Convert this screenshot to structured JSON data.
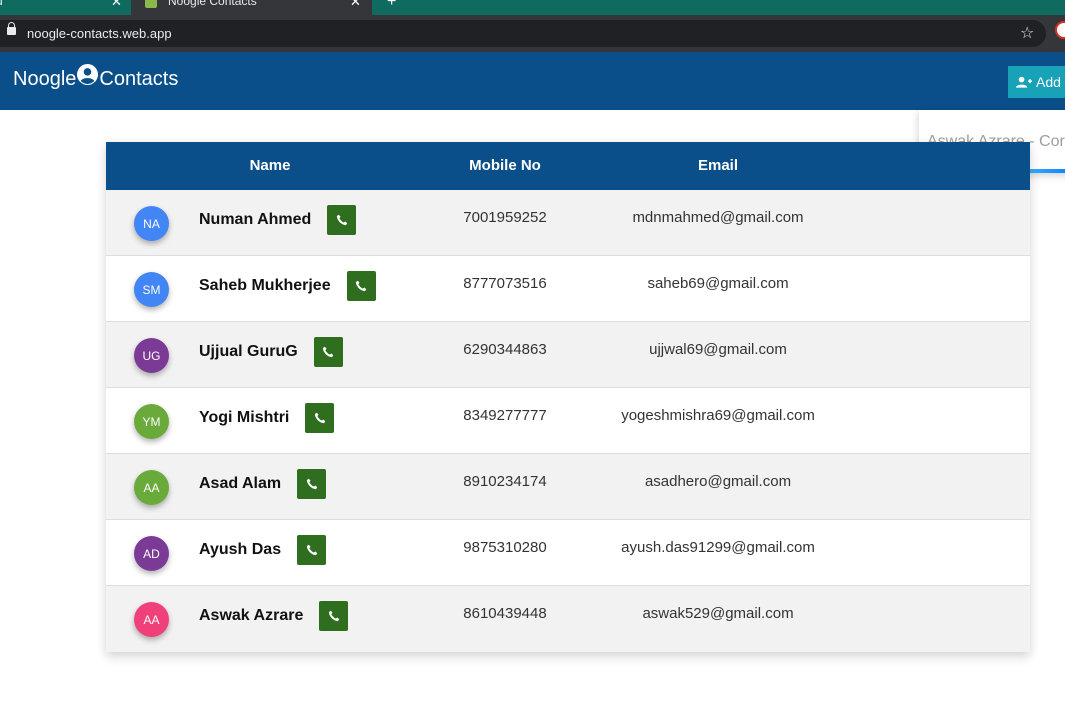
{
  "browser": {
    "tabs": [
      {
        "title": "d"
      },
      {
        "title": "Noogle Contacts"
      }
    ],
    "url": "noogle-contacts.web.app"
  },
  "navbar": {
    "brand_left": "Noogle",
    "brand_right": "Contacts",
    "add_label": "Add"
  },
  "toast": {
    "text": "Aswak Azrare - Cor"
  },
  "table": {
    "headers": [
      "Name",
      "Mobile No",
      "Email"
    ],
    "rows": [
      {
        "initials": "NA",
        "avatar_color": "#4285f4",
        "name": "Numan Ahmed",
        "mobile": "7001959252",
        "email": "mdnmahmed@gmail.com"
      },
      {
        "initials": "SM",
        "avatar_color": "#4285f4",
        "name": "Saheb Mukherjee",
        "mobile": "8777073516",
        "email": "saheb69@gmail.com"
      },
      {
        "initials": "UG",
        "avatar_color": "#7b3a96",
        "name": "Ujjual GuruG",
        "mobile": "6290344863",
        "email": "ujjwal69@gmail.com"
      },
      {
        "initials": "YM",
        "avatar_color": "#6aaa3a",
        "name": "Yogi Mishtri",
        "mobile": "8349277777",
        "email": "yogeshmishra69@gmail.com"
      },
      {
        "initials": "AA",
        "avatar_color": "#6aaa3a",
        "name": "Asad Alam",
        "mobile": "8910234174",
        "email": "asadhero@gmail.com"
      },
      {
        "initials": "AD",
        "avatar_color": "#7b3a96",
        "name": "Ayush Das",
        "mobile": "9875310280",
        "email": "ayush.das91299@gmail.com"
      },
      {
        "initials": "AA",
        "avatar_color": "#f0407a",
        "name": "Aswak Azrare",
        "mobile": "8610439448",
        "email": "aswak529@gmail.com"
      }
    ]
  },
  "colors": {
    "navbar": "#0a4f8a",
    "call_button": "#2e6e1e",
    "add_button": "#17a2b8"
  },
  "icons": {
    "brand": "user-circle-icon",
    "add": "user-plus-icon",
    "call": "phone-icon",
    "lock": "lock-icon",
    "bookmark": "star-icon"
  }
}
